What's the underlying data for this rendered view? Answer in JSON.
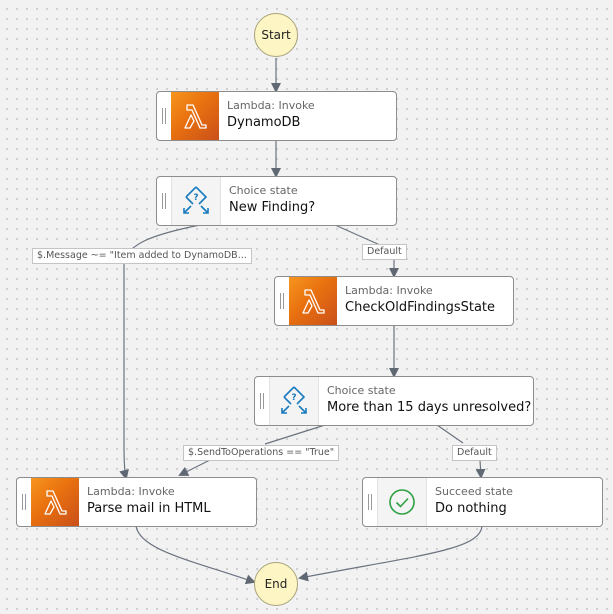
{
  "start": {
    "label": "Start"
  },
  "end": {
    "label": "End"
  },
  "nodes": {
    "dynamodb": {
      "type": "Lambda: Invoke",
      "name": "DynamoDB",
      "icon": "lambda-icon"
    },
    "new_finding": {
      "type": "Choice state",
      "name": "New Finding?",
      "icon": "choice-icon"
    },
    "check_old": {
      "type": "Lambda: Invoke",
      "name": "CheckOldFindingsState",
      "icon": "lambda-icon"
    },
    "more_than_15": {
      "type": "Choice state",
      "name": "More than 15 days unresolved?",
      "icon": "choice-icon"
    },
    "parse_mail": {
      "type": "Lambda: Invoke",
      "name": "Parse mail in HTML",
      "icon": "lambda-icon"
    },
    "do_nothing": {
      "type": "Succeed state",
      "name": "Do nothing",
      "icon": "check-circle-icon"
    }
  },
  "edge_labels": {
    "message_condition": "$.Message ~= \"Item added to DynamoDB...",
    "default_1": "Default",
    "send_to_operations": "$.SendToOperations == \"True\"",
    "default_2": "Default"
  },
  "colors": {
    "lambda_orange": "#e8700f",
    "choice_blue": "#1a7bbf",
    "succeed_green": "#2ea043",
    "terminal_fill": "#fdf6c4",
    "edge": "#5f6873"
  }
}
